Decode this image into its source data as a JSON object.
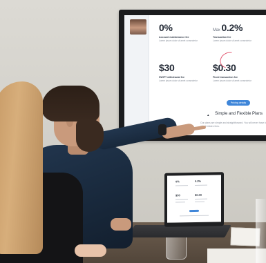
{
  "tv_screen": {
    "pricing": [
      {
        "value": "0%",
        "prefix": "",
        "name": "Account maintenance fee",
        "desc": "Lorem ipsum dolor sit amet consectetur"
      },
      {
        "value": "0.2%",
        "prefix": "Max",
        "name": "Transaction fee",
        "desc": "Lorem ipsum dolor sit amet consectetur"
      },
      {
        "value": "$30",
        "prefix": "",
        "name": "SWIFT withdrawal fee",
        "desc": "Lorem ipsum dolor sit amet consectetur"
      },
      {
        "value": "$0.30",
        "prefix": "",
        "name": "Fixed transaction fee",
        "desc": "Lorem ipsum dolor sit amet consectetur"
      }
    ],
    "button_label": "Pricing details",
    "section_heading": "Simple and Flexible Plans",
    "section_text": "Our plans are simple and straightforward. You will never have to worry about hidden fees."
  },
  "laptop_screen": {
    "values": [
      "0%",
      "0.2%",
      "$30",
      "$0.30"
    ]
  }
}
